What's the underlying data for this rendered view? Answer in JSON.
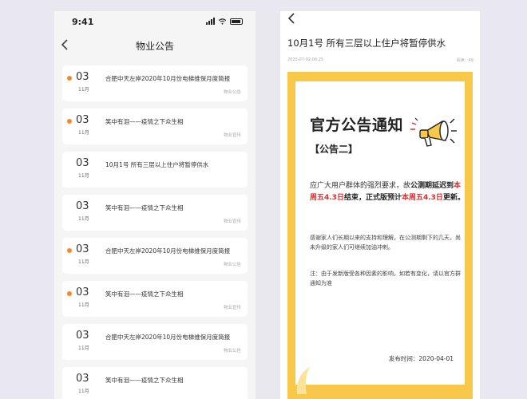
{
  "left": {
    "status_time": "9:41",
    "nav_title": "物业公告",
    "back_icon": "chevron-left-icon",
    "items": [
      {
        "day": "03",
        "month": "11月",
        "title": "合肥中天左岸2020年10月份电梯维保月度简报",
        "category": "物业公告",
        "unread": true
      },
      {
        "day": "03",
        "month": "11月",
        "title": "笑中有泪——疫情之下众生相",
        "category": "物业宣传",
        "unread": true
      },
      {
        "day": "03",
        "month": "11月",
        "title": "10月1号  所有三层以上住户将暂停供水",
        "category": "",
        "unread": false
      },
      {
        "day": "03",
        "month": "11月",
        "title": "笑中有泪——疫情之下众生相",
        "category": "物业宣传",
        "unread": false
      },
      {
        "day": "03",
        "month": "11月",
        "title": "合肥中天左岸2020年10月份电梯维保月度简报",
        "category": "物业公告",
        "unread": true
      },
      {
        "day": "03",
        "month": "11月",
        "title": "笑中有泪——疫情之下众生相",
        "category": "物业宣传",
        "unread": true
      },
      {
        "day": "03",
        "month": "11月",
        "title": "合肥中天左岸2020年10月份电梯维保月度简报",
        "category": "物业公告",
        "unread": false
      },
      {
        "day": "03",
        "month": "11月",
        "title": "笑中有泪——疫情之下众生相",
        "category": "",
        "unread": false
      }
    ]
  },
  "right": {
    "back_icon": "chevron-left-icon",
    "title": "10月1号  所有三层以上住户将暂停供水",
    "date": "2020-07-02  06:25",
    "read_count": "阅读：49",
    "notice_title": "官方公告通知",
    "notice_sub": "【公告二】",
    "para1_a": "应广大用户群体的强烈要求，故",
    "para1_b": "公测期延迟到",
    "para1_c": "本周五4.3日",
    "para1_d": "结束，",
    "para1_e": "正式版预计",
    "para1_f": "本周五4.3日",
    "para1_g": "更新。",
    "para2": "感谢家人们长期以来的支持和理解，在公测期剩下的几天，尚未升级的家人们可继续加油冲刺。",
    "para3": "注：由于发新版受各种因素的影响，如若有变化，请以官方群通知为准",
    "pubdate": "发布时间：2020-04-01",
    "megaphone_icon": "megaphone-icon"
  },
  "colors": {
    "accent": "#f08a2c",
    "poster": "#f7c84a",
    "highlight": "#e52d2d"
  }
}
